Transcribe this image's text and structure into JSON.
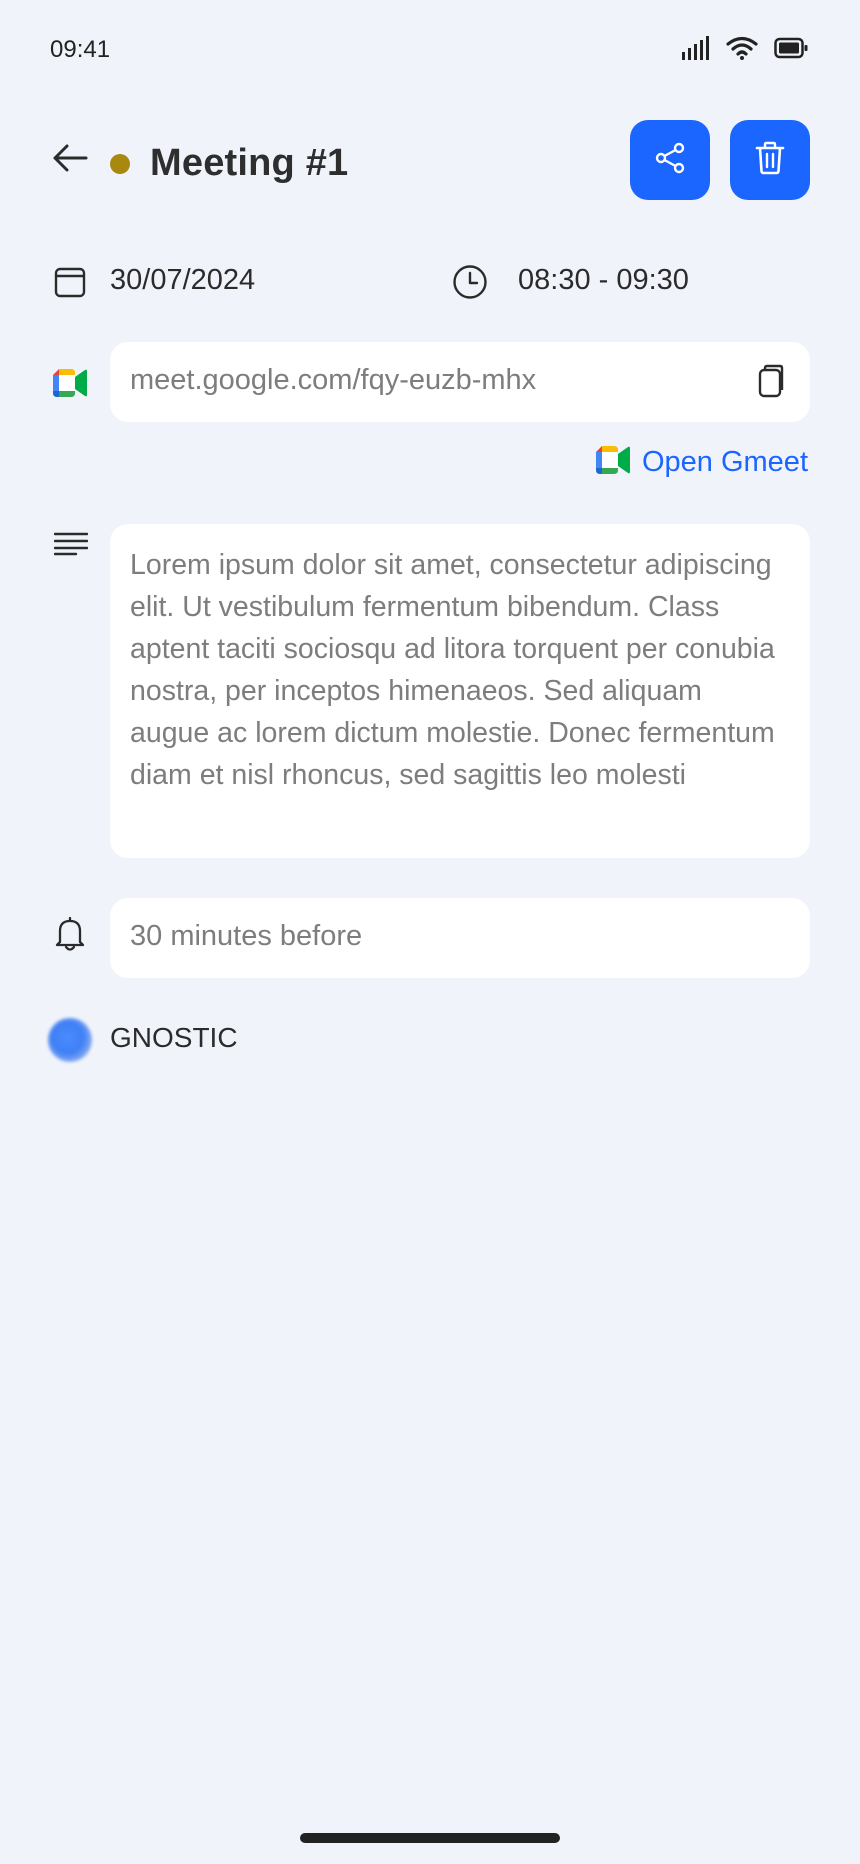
{
  "status_bar": {
    "time": "09:41",
    "icons": [
      "signal-icon",
      "wifi-icon",
      "battery-icon"
    ]
  },
  "header": {
    "title": "Meeting #1",
    "event_color": "#a8880e",
    "actions": [
      {
        "name": "share-button",
        "icon": "share-icon"
      },
      {
        "name": "delete-button",
        "icon": "trash-icon"
      }
    ],
    "accent_color": "#1a66ff"
  },
  "schedule": {
    "date": "30/07/2024",
    "time_range": "08:30 - 09:30"
  },
  "meeting_link": {
    "url": "meet.google.com/fqy-euzb-mhx",
    "open_label": "Open Gmeet"
  },
  "description": {
    "text": "Lorem ipsum dolor sit amet, consectetur adipiscing elit. Ut vestibulum fermentum bibendum. Class aptent taciti sociosqu ad litora torquent per conubia nostra, per inceptos himenaeos. Sed aliquam augue ac lorem dictum molestie. Donec fermentum diam et nisl rhoncus, sed sagittis leo molesti"
  },
  "reminder": {
    "value": "30 minutes before"
  },
  "attendee": {
    "name": "GNOSTIC"
  }
}
